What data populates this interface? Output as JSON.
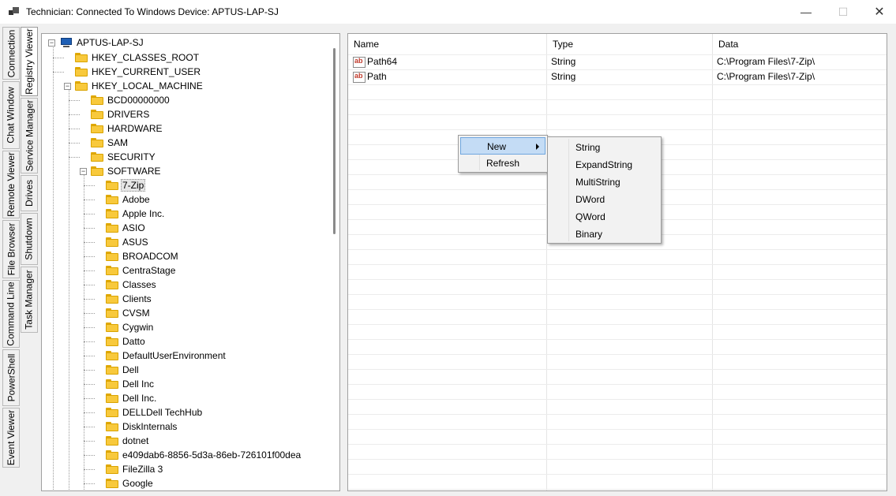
{
  "window": {
    "title": "Technician: Connected To Windows Device: APTUS-LAP-SJ",
    "minimize_icon": "minimize-icon",
    "maximize_icon": "maximize-icon",
    "close_icon": "close-icon"
  },
  "tabs_col1": [
    {
      "label": "Connection",
      "active": false
    },
    {
      "label": "Chat Window",
      "active": false
    },
    {
      "label": "Remote Viewer",
      "active": false
    },
    {
      "label": "File Browser",
      "active": false
    },
    {
      "label": "Command Line",
      "active": false
    },
    {
      "label": "PowerShell",
      "active": false
    },
    {
      "label": "Event Viewer",
      "active": false
    }
  ],
  "tabs_col2": [
    {
      "label": "Registry Viewer",
      "active": true
    },
    {
      "label": "Service Manager",
      "active": false
    },
    {
      "label": "Drives",
      "active": false
    },
    {
      "label": "Shutdown",
      "active": false
    },
    {
      "label": "Task Manager",
      "active": false
    }
  ],
  "tree": {
    "root": "APTUS-LAP-SJ",
    "hives": [
      "HKEY_CLASSES_ROOT",
      "HKEY_CURRENT_USER",
      "HKEY_LOCAL_MACHINE"
    ],
    "hklm_children": [
      "BCD00000000",
      "DRIVERS",
      "HARDWARE",
      "SAM",
      "SECURITY",
      "SOFTWARE"
    ],
    "software_children": [
      "7-Zip",
      "Adobe",
      "Apple Inc.",
      "ASIO",
      "ASUS",
      "BROADCOM",
      "CentraStage",
      "Classes",
      "Clients",
      "CVSM",
      "Cygwin",
      "Datto",
      "DefaultUserEnvironment",
      "Dell",
      "Dell Inc",
      "Dell Inc.",
      "DELLDell TechHub",
      "DiskInternals",
      "dotnet",
      "e409dab6-8856-5d3a-86eb-726101f00dea",
      "FileZilla 3",
      "Google"
    ],
    "selected": "7-Zip"
  },
  "list": {
    "columns": [
      "Name",
      "Type",
      "Data"
    ],
    "rows": [
      {
        "name": "Path64",
        "type": "String",
        "data": "C:\\Program Files\\7-Zip\\",
        "icon": "string-value-icon"
      },
      {
        "name": "Path",
        "type": "String",
        "data": "C:\\Program Files\\7-Zip\\",
        "icon": "string-value-icon"
      }
    ]
  },
  "context_menu": {
    "items": [
      "New",
      "Refresh"
    ],
    "highlighted": "New"
  },
  "submenu": {
    "items": [
      "String",
      "ExpandString",
      "MultiString",
      "DWord",
      "QWord",
      "Binary"
    ]
  }
}
